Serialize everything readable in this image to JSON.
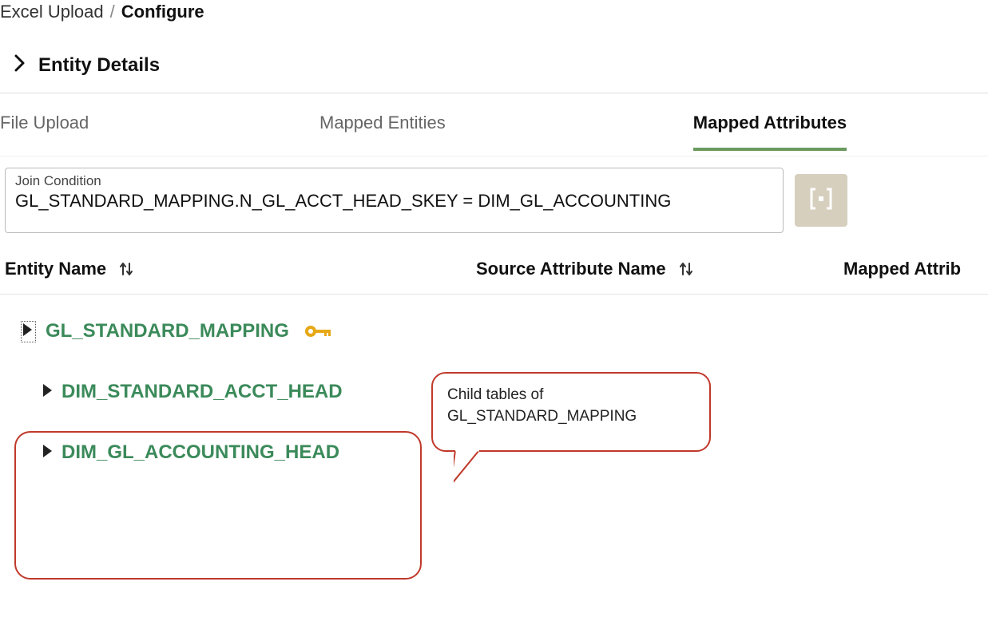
{
  "breadcrumb": {
    "parent": "Excel Upload",
    "current": "Configure"
  },
  "section_title": "Entity Details",
  "tabs": {
    "file_upload": "File Upload",
    "mapped_entities": "Mapped Entities",
    "mapped_attributes": "Mapped Attributes"
  },
  "join": {
    "label": "Join Condition",
    "value": "GL_STANDARD_MAPPING.N_GL_ACCT_HEAD_SKEY = DIM_GL_ACCOUNTING"
  },
  "columns": {
    "entity_name": "Entity Name",
    "source_attr": "Source Attribute Name",
    "mapped_attr": "Mapped Attrib"
  },
  "entities": [
    {
      "name": "GL_STANDARD_MAPPING",
      "is_key": true
    },
    {
      "name": "DIM_STANDARD_ACCT_HEAD",
      "is_key": false
    },
    {
      "name": "DIM_GL_ACCOUNTING_HEAD",
      "is_key": false
    }
  ],
  "callout": {
    "line1": "Child tables of",
    "line2": "GL_STANDARD_MAPPING"
  }
}
